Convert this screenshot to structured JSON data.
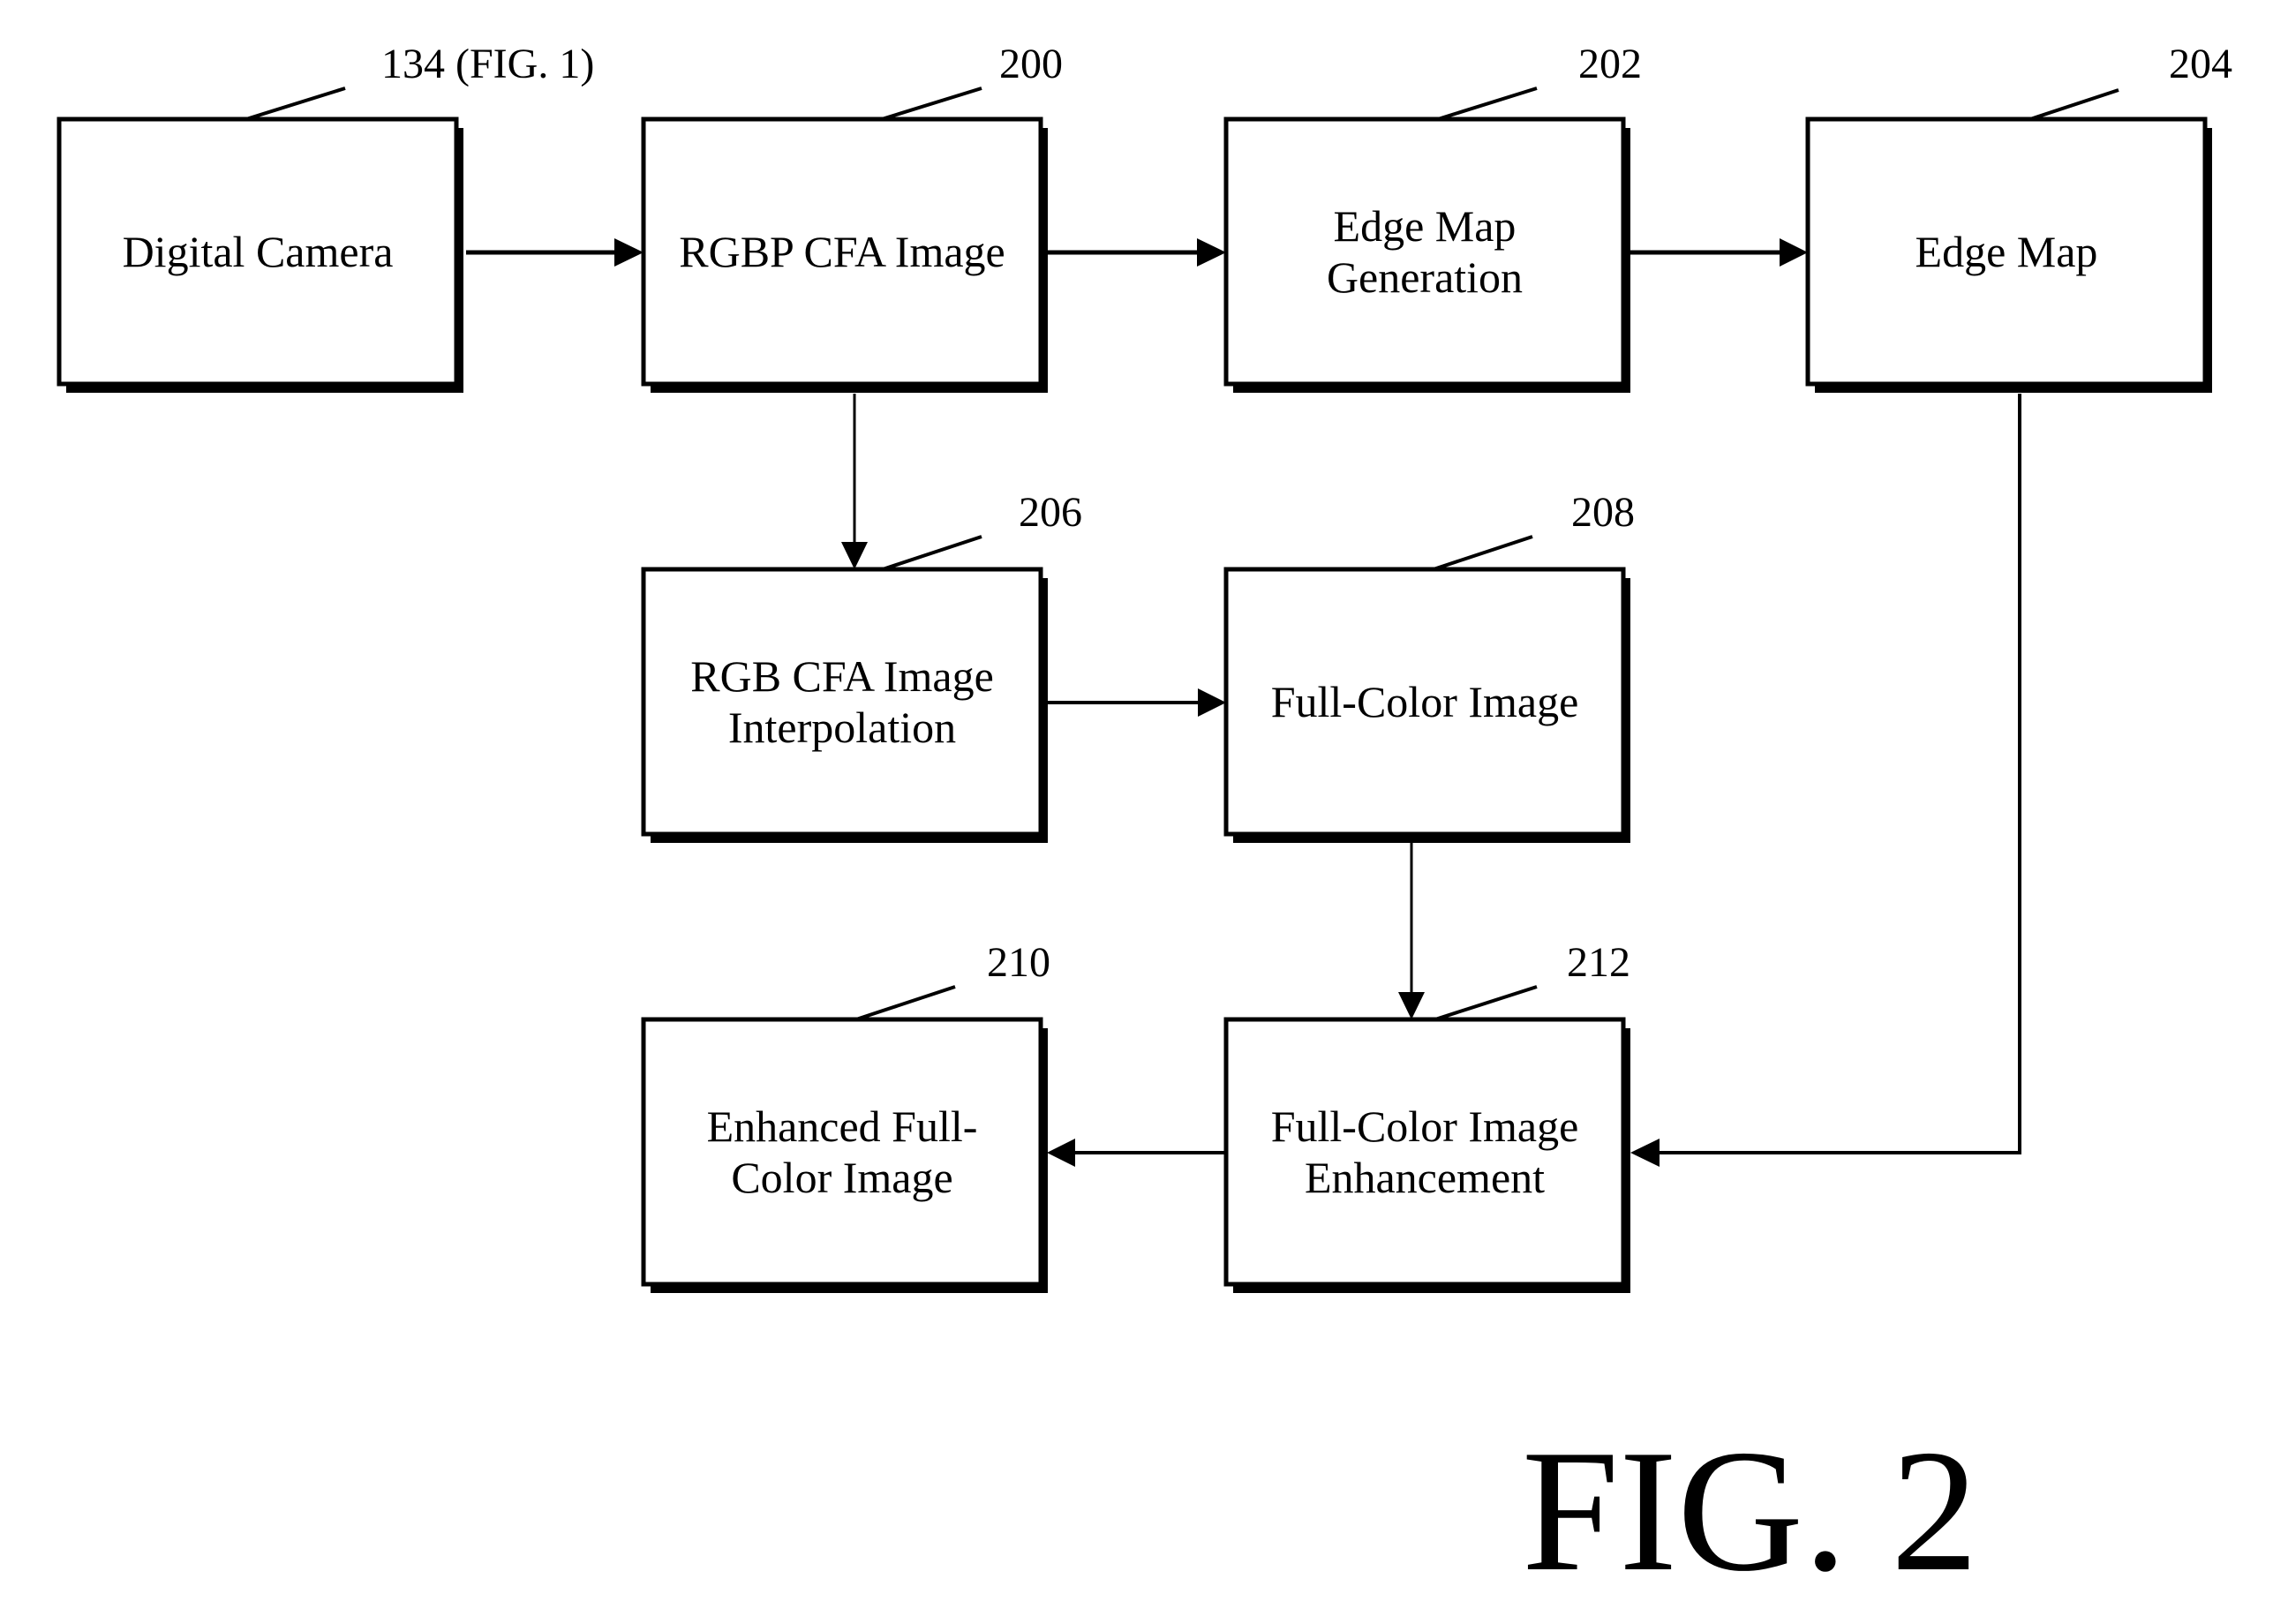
{
  "figure": {
    "title": "FIG. 2"
  },
  "blocks": [
    {
      "id": "camera",
      "ref": "134 (FIG. 1)",
      "lines": [
        "Digital Camera"
      ]
    },
    {
      "id": "rgbp",
      "ref": "200",
      "lines": [
        "RGBP CFA Image"
      ]
    },
    {
      "id": "edgegen",
      "ref": "202",
      "lines": [
        "Edge Map",
        "Generation"
      ]
    },
    {
      "id": "edgemap",
      "ref": "204",
      "lines": [
        "Edge Map"
      ]
    },
    {
      "id": "interp",
      "ref": "206",
      "lines": [
        "RGB CFA Image",
        "Interpolation"
      ]
    },
    {
      "id": "fullcolor",
      "ref": "208",
      "lines": [
        "Full-Color Image"
      ]
    },
    {
      "id": "enhanced",
      "ref": "210",
      "lines": [
        "Enhanced Full-",
        "Color Image"
      ]
    },
    {
      "id": "enhance",
      "ref": "212",
      "lines": [
        "Full-Color Image",
        "Enhancement"
      ]
    }
  ],
  "connections": [
    {
      "from": "camera",
      "to": "rgbp"
    },
    {
      "from": "rgbp",
      "to": "edgegen"
    },
    {
      "from": "edgegen",
      "to": "edgemap"
    },
    {
      "from": "rgbp",
      "to": "interp"
    },
    {
      "from": "interp",
      "to": "fullcolor"
    },
    {
      "from": "fullcolor",
      "to": "enhance"
    },
    {
      "from": "edgemap",
      "to": "enhance"
    },
    {
      "from": "enhance",
      "to": "enhanced"
    }
  ]
}
